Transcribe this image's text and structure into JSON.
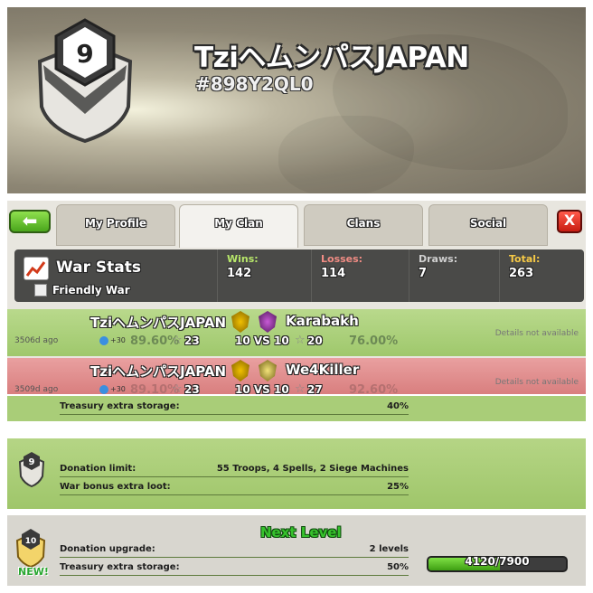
{
  "header": {
    "clan_level": "9",
    "clan_name": "TziヘムンパスJAPAN",
    "clan_tag": "#898Y2QL0"
  },
  "nav": {
    "tabs": [
      "My Profile",
      "My Clan",
      "Clans",
      "Social"
    ],
    "active_tab": "My Clan",
    "close_label": "X"
  },
  "war_stats": {
    "title": "War Stats",
    "friendly_label": "Friendly War",
    "friendly_checked": false,
    "wins_label": "Wins:",
    "wins": "142",
    "losses_label": "Losses:",
    "losses": "114",
    "draws_label": "Draws:",
    "draws": "7",
    "total_label": "Total:",
    "total": "263"
  },
  "wars": [
    {
      "ago": "3506d ago",
      "clan": "TziヘムンパスJAPAN",
      "clan_exp": "+30",
      "clan_pct": "89.60%",
      "clan_stars": "23",
      "size": "10 VS 10",
      "opponent": "Karabakh",
      "opp_stars": "20",
      "opp_pct": "76.00%",
      "note": "Details not available",
      "result": "win"
    },
    {
      "ago": "3509d ago",
      "clan": "TziヘムンパスJAPAN",
      "clan_exp": "+30",
      "clan_pct": "89.10%",
      "clan_stars": "23",
      "size": "10 VS 10",
      "opponent": "We4Killer",
      "opp_stars": "27",
      "opp_pct": "92.60%",
      "note": "Details not available",
      "result": "loss"
    }
  ],
  "perks": {
    "top": {
      "label": "Treasury extra storage:",
      "value": "40%"
    },
    "current_level": "9",
    "current": [
      {
        "label": "Donation limit:",
        "value": "55 Troops, 4 Spells, 2 Siege Machines"
      },
      {
        "label": "War bonus extra loot:",
        "value": "25%"
      }
    ],
    "next_title": "Next Level",
    "next_level": "10",
    "new_label": "NEW!",
    "next": [
      {
        "label": "Donation upgrade:",
        "value": "2 levels"
      },
      {
        "label": "Treasury extra storage:",
        "value": "50%"
      }
    ],
    "xp_current": 4120,
    "xp_total": 7900,
    "xp_text": "4120/7900"
  },
  "colors": {
    "win_row": "#a8cf78",
    "loss_row": "#df8b8b",
    "stats_bar": "#4a4a48",
    "next_level_green": "#36c22c",
    "xp_fill": "#5cc22a"
  }
}
